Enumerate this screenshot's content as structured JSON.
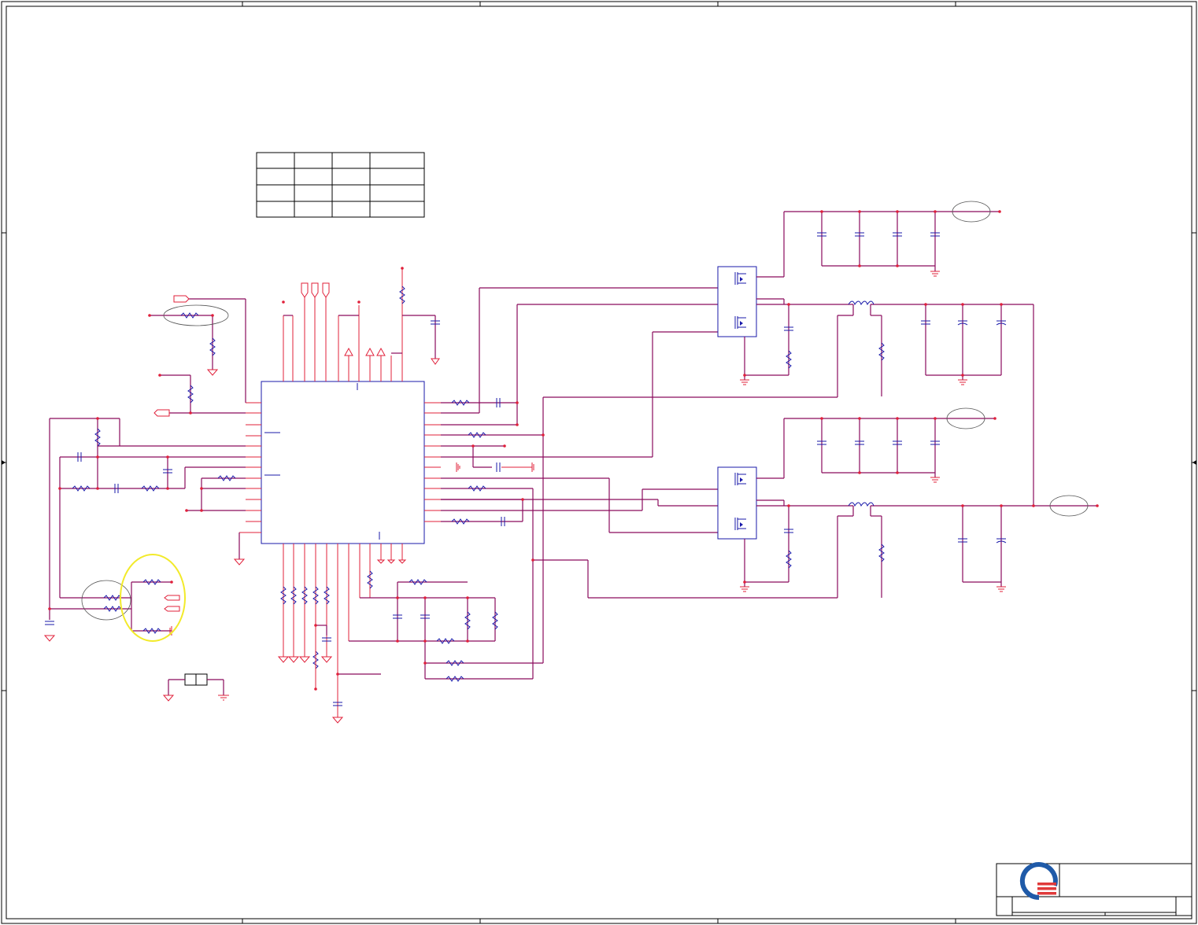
{
  "drawing": {
    "title": "",
    "colors": {
      "wire": "#8a0a5c",
      "pin": "#e0203a",
      "component": "#1a1aaa",
      "frame": "#000000",
      "highlight": "#f2ea2a",
      "logo_blue": "#1f5aa8",
      "logo_red": "#e03a3a"
    },
    "logo_icon": "company-logo-icon",
    "config_table": {
      "rows": 4,
      "cols": 4,
      "cells": []
    }
  }
}
